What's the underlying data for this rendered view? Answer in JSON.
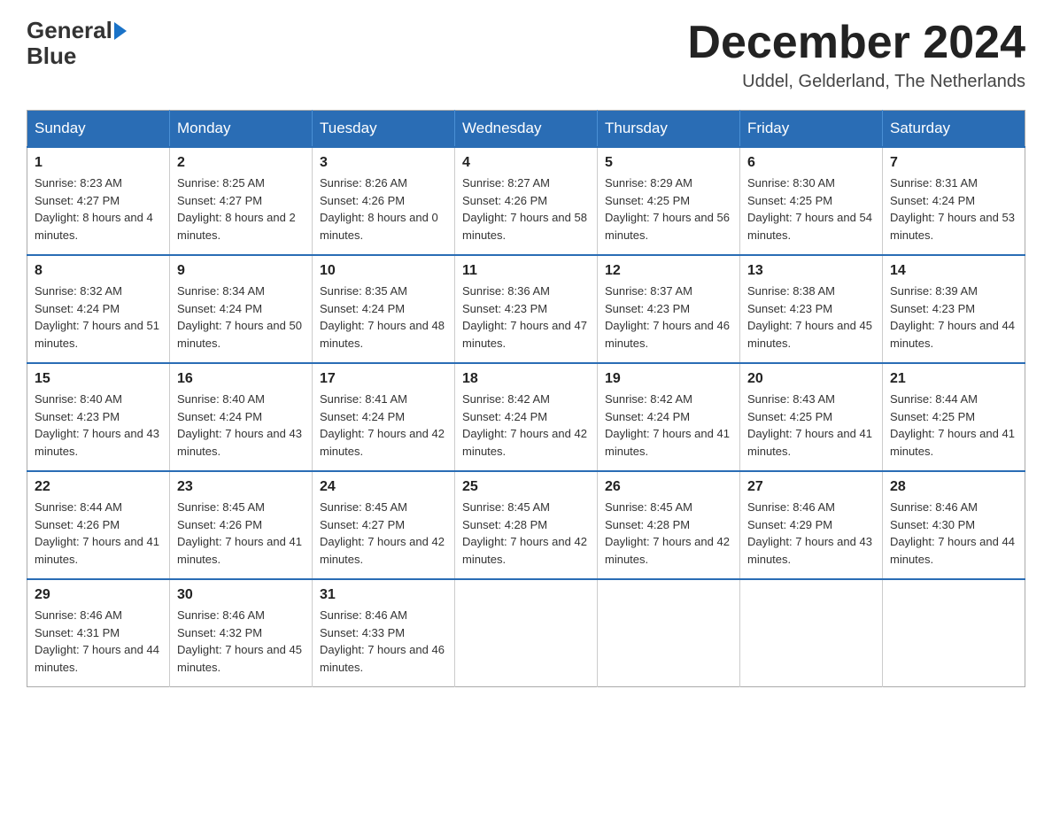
{
  "logo": {
    "text_general": "General",
    "text_blue": "Blue"
  },
  "header": {
    "month": "December 2024",
    "location": "Uddel, Gelderland, The Netherlands"
  },
  "days_of_week": [
    "Sunday",
    "Monday",
    "Tuesday",
    "Wednesday",
    "Thursday",
    "Friday",
    "Saturday"
  ],
  "weeks": [
    [
      {
        "day": "1",
        "sunrise": "Sunrise: 8:23 AM",
        "sunset": "Sunset: 4:27 PM",
        "daylight": "Daylight: 8 hours and 4 minutes."
      },
      {
        "day": "2",
        "sunrise": "Sunrise: 8:25 AM",
        "sunset": "Sunset: 4:27 PM",
        "daylight": "Daylight: 8 hours and 2 minutes."
      },
      {
        "day": "3",
        "sunrise": "Sunrise: 8:26 AM",
        "sunset": "Sunset: 4:26 PM",
        "daylight": "Daylight: 8 hours and 0 minutes."
      },
      {
        "day": "4",
        "sunrise": "Sunrise: 8:27 AM",
        "sunset": "Sunset: 4:26 PM",
        "daylight": "Daylight: 7 hours and 58 minutes."
      },
      {
        "day": "5",
        "sunrise": "Sunrise: 8:29 AM",
        "sunset": "Sunset: 4:25 PM",
        "daylight": "Daylight: 7 hours and 56 minutes."
      },
      {
        "day": "6",
        "sunrise": "Sunrise: 8:30 AM",
        "sunset": "Sunset: 4:25 PM",
        "daylight": "Daylight: 7 hours and 54 minutes."
      },
      {
        "day": "7",
        "sunrise": "Sunrise: 8:31 AM",
        "sunset": "Sunset: 4:24 PM",
        "daylight": "Daylight: 7 hours and 53 minutes."
      }
    ],
    [
      {
        "day": "8",
        "sunrise": "Sunrise: 8:32 AM",
        "sunset": "Sunset: 4:24 PM",
        "daylight": "Daylight: 7 hours and 51 minutes."
      },
      {
        "day": "9",
        "sunrise": "Sunrise: 8:34 AM",
        "sunset": "Sunset: 4:24 PM",
        "daylight": "Daylight: 7 hours and 50 minutes."
      },
      {
        "day": "10",
        "sunrise": "Sunrise: 8:35 AM",
        "sunset": "Sunset: 4:24 PM",
        "daylight": "Daylight: 7 hours and 48 minutes."
      },
      {
        "day": "11",
        "sunrise": "Sunrise: 8:36 AM",
        "sunset": "Sunset: 4:23 PM",
        "daylight": "Daylight: 7 hours and 47 minutes."
      },
      {
        "day": "12",
        "sunrise": "Sunrise: 8:37 AM",
        "sunset": "Sunset: 4:23 PM",
        "daylight": "Daylight: 7 hours and 46 minutes."
      },
      {
        "day": "13",
        "sunrise": "Sunrise: 8:38 AM",
        "sunset": "Sunset: 4:23 PM",
        "daylight": "Daylight: 7 hours and 45 minutes."
      },
      {
        "day": "14",
        "sunrise": "Sunrise: 8:39 AM",
        "sunset": "Sunset: 4:23 PM",
        "daylight": "Daylight: 7 hours and 44 minutes."
      }
    ],
    [
      {
        "day": "15",
        "sunrise": "Sunrise: 8:40 AM",
        "sunset": "Sunset: 4:23 PM",
        "daylight": "Daylight: 7 hours and 43 minutes."
      },
      {
        "day": "16",
        "sunrise": "Sunrise: 8:40 AM",
        "sunset": "Sunset: 4:24 PM",
        "daylight": "Daylight: 7 hours and 43 minutes."
      },
      {
        "day": "17",
        "sunrise": "Sunrise: 8:41 AM",
        "sunset": "Sunset: 4:24 PM",
        "daylight": "Daylight: 7 hours and 42 minutes."
      },
      {
        "day": "18",
        "sunrise": "Sunrise: 8:42 AM",
        "sunset": "Sunset: 4:24 PM",
        "daylight": "Daylight: 7 hours and 42 minutes."
      },
      {
        "day": "19",
        "sunrise": "Sunrise: 8:42 AM",
        "sunset": "Sunset: 4:24 PM",
        "daylight": "Daylight: 7 hours and 41 minutes."
      },
      {
        "day": "20",
        "sunrise": "Sunrise: 8:43 AM",
        "sunset": "Sunset: 4:25 PM",
        "daylight": "Daylight: 7 hours and 41 minutes."
      },
      {
        "day": "21",
        "sunrise": "Sunrise: 8:44 AM",
        "sunset": "Sunset: 4:25 PM",
        "daylight": "Daylight: 7 hours and 41 minutes."
      }
    ],
    [
      {
        "day": "22",
        "sunrise": "Sunrise: 8:44 AM",
        "sunset": "Sunset: 4:26 PM",
        "daylight": "Daylight: 7 hours and 41 minutes."
      },
      {
        "day": "23",
        "sunrise": "Sunrise: 8:45 AM",
        "sunset": "Sunset: 4:26 PM",
        "daylight": "Daylight: 7 hours and 41 minutes."
      },
      {
        "day": "24",
        "sunrise": "Sunrise: 8:45 AM",
        "sunset": "Sunset: 4:27 PM",
        "daylight": "Daylight: 7 hours and 42 minutes."
      },
      {
        "day": "25",
        "sunrise": "Sunrise: 8:45 AM",
        "sunset": "Sunset: 4:28 PM",
        "daylight": "Daylight: 7 hours and 42 minutes."
      },
      {
        "day": "26",
        "sunrise": "Sunrise: 8:45 AM",
        "sunset": "Sunset: 4:28 PM",
        "daylight": "Daylight: 7 hours and 42 minutes."
      },
      {
        "day": "27",
        "sunrise": "Sunrise: 8:46 AM",
        "sunset": "Sunset: 4:29 PM",
        "daylight": "Daylight: 7 hours and 43 minutes."
      },
      {
        "day": "28",
        "sunrise": "Sunrise: 8:46 AM",
        "sunset": "Sunset: 4:30 PM",
        "daylight": "Daylight: 7 hours and 44 minutes."
      }
    ],
    [
      {
        "day": "29",
        "sunrise": "Sunrise: 8:46 AM",
        "sunset": "Sunset: 4:31 PM",
        "daylight": "Daylight: 7 hours and 44 minutes."
      },
      {
        "day": "30",
        "sunrise": "Sunrise: 8:46 AM",
        "sunset": "Sunset: 4:32 PM",
        "daylight": "Daylight: 7 hours and 45 minutes."
      },
      {
        "day": "31",
        "sunrise": "Sunrise: 8:46 AM",
        "sunset": "Sunset: 4:33 PM",
        "daylight": "Daylight: 7 hours and 46 minutes."
      },
      null,
      null,
      null,
      null
    ]
  ]
}
